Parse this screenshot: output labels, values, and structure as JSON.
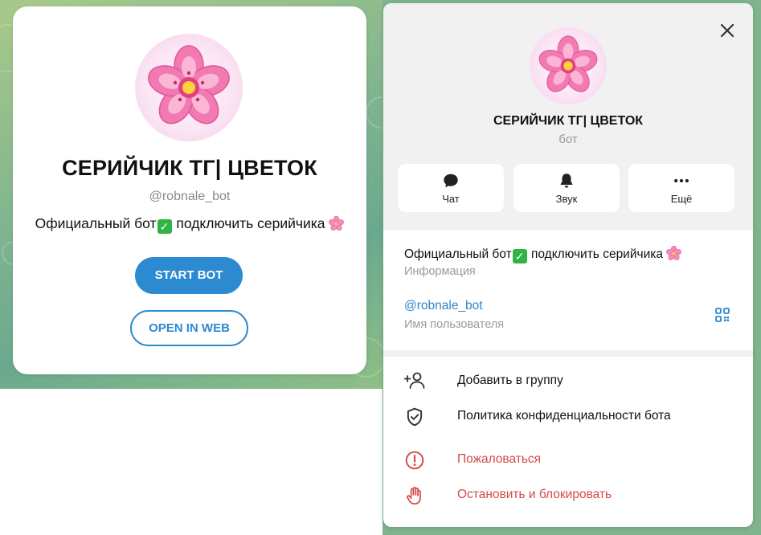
{
  "web_card": {
    "title": "СЕРИЙЧИК ТГ| ЦВЕТОК",
    "username": "@robnale_bot",
    "desc_before": "Официальный бот",
    "desc_after": " подключить серийчика ",
    "start_label": "START BOT",
    "web_label": "OPEN IN WEB"
  },
  "panel": {
    "title": "СЕРИЙЧИК ТГ| ЦВЕТОК",
    "subtitle": "бот",
    "actions": [
      {
        "label": "Чат",
        "icon": "chat-bubble-icon"
      },
      {
        "label": "Звук",
        "icon": "bell-icon"
      },
      {
        "label": "Ещё",
        "icon": "more-dots-icon"
      }
    ],
    "info": {
      "desc_before": "Официальный бот",
      "desc_after": " подключить серийчика ",
      "desc_label": "Информация",
      "username": "@robnale_bot",
      "username_label": "Имя пользователя"
    },
    "menu": [
      {
        "label": "Добавить в группу",
        "icon": "add-user-icon",
        "danger": false
      },
      {
        "label": "Политика конфиденциальности бота",
        "icon": "shield-check-icon",
        "danger": false
      },
      {
        "label": "Пожаловаться",
        "icon": "report-icon",
        "danger": true
      },
      {
        "label": "Остановить и блокировать",
        "icon": "stop-hand-icon",
        "danger": true
      }
    ]
  },
  "colors": {
    "accent": "#2c8ad1",
    "danger": "#d44a4a",
    "check": "#2fb344",
    "flower": "#f06aa8"
  }
}
